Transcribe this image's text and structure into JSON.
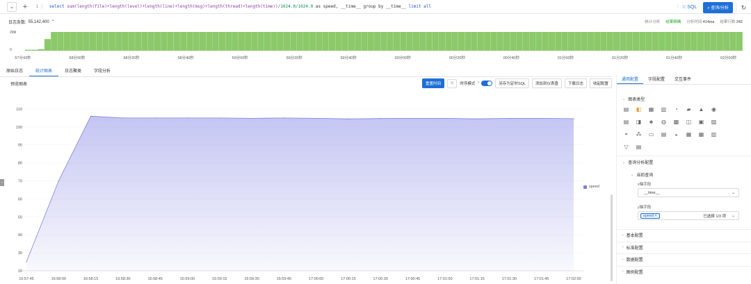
{
  "query_bar": {
    "line_number": "1",
    "separator": "|",
    "query_parts": [
      {
        "t": "select ",
        "c": "kw"
      },
      {
        "t": "sum(length(file)+length(level)+length(line)+length(msg)+length(thread)+length(time))",
        "c": "fn"
      },
      {
        "t": "/1024.0/1024.0",
        "c": "num"
      },
      {
        "t": " as speed, __time__ group by __time__ ",
        "c": "plain"
      },
      {
        "t": "limit all",
        "c": "kw"
      }
    ],
    "sql_label": "SQL",
    "search_button": "查询/分析"
  },
  "histogram": {
    "count_label": "日志条数:",
    "count_value": "55,142,400",
    "stats": [
      {
        "label": "统计分析",
        "value": ""
      },
      {
        "label": "结果精确",
        "value": "",
        "ok": true
      },
      {
        "label": "分析时间:",
        "value": "414ms"
      },
      {
        "label": "结果行数:",
        "value": "242"
      }
    ],
    "y_ticks": [
      "2Mil",
      "0"
    ],
    "x_ticks": [
      "57分43秒",
      "58分00秒",
      "58分20秒",
      "58分40秒",
      "59分00秒",
      "59分20秒",
      "59分40秒",
      "00分00秒",
      "00分20秒",
      "00分40秒",
      "01分00秒",
      "01分20秒",
      "01分40秒",
      "02分00秒"
    ],
    "bar_color": "#8bc96a",
    "bars": [
      0.05,
      0.05,
      0.08,
      0.62,
      1,
      1,
      1,
      1,
      1,
      1,
      1,
      1,
      1,
      1,
      1,
      1,
      1,
      1,
      1,
      1,
      1,
      1,
      1,
      1,
      1,
      1,
      1,
      1,
      1,
      1,
      1,
      1,
      1,
      1,
      1,
      1,
      1,
      1,
      1,
      1,
      1,
      1,
      1,
      1,
      1,
      1,
      1,
      1,
      1,
      1,
      1,
      1,
      1,
      1,
      1,
      1,
      1,
      1,
      1,
      1,
      1,
      1,
      1,
      1,
      1,
      1,
      1,
      1,
      1,
      1,
      1,
      1,
      1,
      1,
      1,
      1,
      1,
      1,
      1,
      1,
      1,
      1,
      1,
      1,
      1,
      1,
      1,
      1,
      1,
      1,
      1,
      1,
      1,
      1,
      1,
      1,
      1,
      1,
      1,
      1,
      1,
      1,
      1,
      1,
      1,
      1,
      1,
      1,
      1,
      1,
      1
    ]
  },
  "tabs": [
    "原始日志",
    "统计图表",
    "日志聚类",
    "字段分析"
  ],
  "active_tab": 1,
  "chart_header": {
    "title": "预览图表",
    "reset_time": "重置时间",
    "time_mode": "时序模式",
    "save_sql": "另存为定时SQL",
    "add_dashboard": "添加到仪表盘",
    "download": "下载日志",
    "save_alert": "收起配置"
  },
  "chart_data": {
    "type": "area",
    "x": [
      "16:57:45",
      "16:58:00",
      "16:58:15",
      "16:58:30",
      "16:58:45",
      "16:59:00",
      "16:59:15",
      "16:59:30",
      "16:59:45",
      "17:00:00",
      "17:00:15",
      "17:00:30",
      "17:00:45",
      "17:01:00",
      "17:01:15",
      "17:01:30",
      "17:01:45",
      "17:02:00"
    ],
    "series": [
      {
        "name": "speed",
        "values": [
          25,
          70,
          106,
          105,
          105,
          105,
          105,
          104.8,
          105,
          104.8,
          104.5,
          104.7,
          104.8,
          104.8,
          104.5,
          104.8,
          104.8,
          104.6
        ]
      }
    ],
    "ylim": [
      20,
      115
    ],
    "yticks": [
      20,
      30,
      40,
      50,
      60,
      70,
      80,
      90,
      100,
      110
    ],
    "color": "#7d7ee3",
    "legend_position": "right"
  },
  "panel": {
    "tabs": [
      "通用配置",
      "字段配置",
      "交互事件"
    ],
    "chart_type_label": "图表类型",
    "chart_type_icons": [
      "table-icon",
      "line-icon",
      "bar-icon",
      "column-icon",
      "pie-icon",
      "area-icon",
      "mountain-icon",
      "gauge-icon",
      "table2-icon",
      "multi-line-icon",
      "map-icon",
      "world-icon",
      "single-icon",
      "chinamap-icon",
      "flow-icon",
      "radar-icon",
      "bar3-icon",
      "grid-icon",
      "number-icon",
      "compare-icon",
      "pin-icon",
      "flow2-icon",
      "heat-icon",
      "bar-group-icon",
      "funnel-icon",
      "custom-icon"
    ],
    "icon_glyphs": [
      "▤",
      "◧",
      "▦",
      "▥",
      "◔",
      "▰",
      "▲",
      "◉",
      "▤",
      "◨",
      "♣",
      "◍",
      "▩",
      "◫",
      "▣",
      "▨",
      "◓",
      "⁂",
      "▭",
      "▤",
      "◒",
      "▦",
      "▦",
      "▥",
      "▽",
      "▤"
    ],
    "query_section": "查询分析配置",
    "current_query": "当前查询",
    "x_axis_label": "x轴字段",
    "x_axis_value": "__time__",
    "y_axis_label": "y轴字段",
    "y_axis_tag": "speed",
    "y_axis_count": "已选择 1/3 项",
    "sections": [
      "基本配置",
      "标准配置",
      "数据配置",
      "图例配置"
    ]
  }
}
